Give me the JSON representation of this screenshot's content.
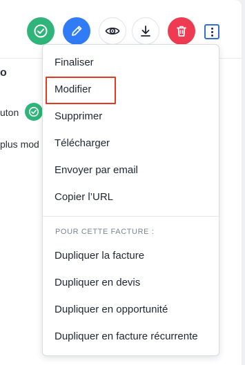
{
  "toolbar": {
    "buttons": [
      {
        "name": "finalize",
        "icon": "check-circle-icon",
        "color": "#2fb47a"
      },
      {
        "name": "edit",
        "icon": "pencil-icon",
        "color": "#2f7cf6"
      },
      {
        "name": "preview",
        "icon": "eye-icon",
        "color": "#ffffff"
      },
      {
        "name": "download",
        "icon": "download-icon",
        "color": "#ffffff"
      },
      {
        "name": "delete",
        "icon": "trash-icon",
        "color": "#ee3b52"
      },
      {
        "name": "more",
        "icon": "more-vertical-icon",
        "color": "#2f6fd6"
      }
    ]
  },
  "background": {
    "partial_top": "o",
    "partial_bouton": "uton",
    "partial_more": "plus mod"
  },
  "menu": {
    "items": [
      {
        "label": "Finaliser"
      },
      {
        "label": "Modifier",
        "highlighted": true
      },
      {
        "label": "Supprimer"
      },
      {
        "label": "Télécharger"
      },
      {
        "label": "Envoyer par email"
      },
      {
        "label": "Copier l’URL"
      }
    ],
    "section_title": "POUR CETTE FACTURE :",
    "section_items": [
      {
        "label": "Dupliquer la facture"
      },
      {
        "label": "Dupliquer en devis"
      },
      {
        "label": "Dupliquer en opportunité"
      },
      {
        "label": "Dupliquer en facture récurrente"
      }
    ]
  },
  "colors": {
    "highlight_border": "#e5391f",
    "success": "#2fb47a",
    "primary": "#2f7cf6",
    "danger": "#ee3b52"
  }
}
